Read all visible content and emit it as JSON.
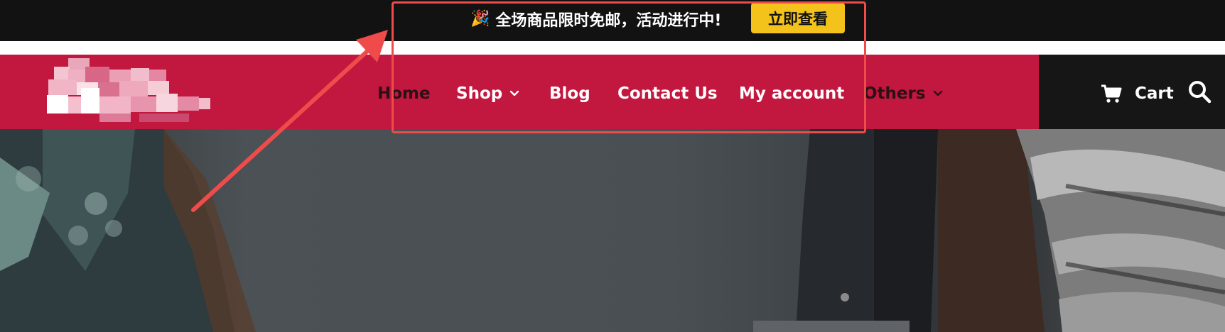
{
  "announcement": {
    "emoji": "🎉",
    "text": "全场商品限时免邮，活动进行中!",
    "cta_label": "立即查看",
    "bar_color": "#121212",
    "cta_color": "#f3c31b"
  },
  "nav": {
    "bar_color": "#c2173f",
    "items": [
      {
        "label": "Home",
        "has_dropdown": false
      },
      {
        "label": "Shop",
        "has_dropdown": true
      },
      {
        "label": "Blog",
        "has_dropdown": false
      },
      {
        "label": "Contact Us",
        "has_dropdown": false
      },
      {
        "label": "My account",
        "has_dropdown": false
      },
      {
        "label": "Others",
        "has_dropdown": true
      }
    ],
    "cart_label": "Cart",
    "icons": [
      "cart-icon",
      "search-icon",
      "chevron-down-icon"
    ]
  },
  "annotation": {
    "box_color": "#ef4b4b"
  }
}
